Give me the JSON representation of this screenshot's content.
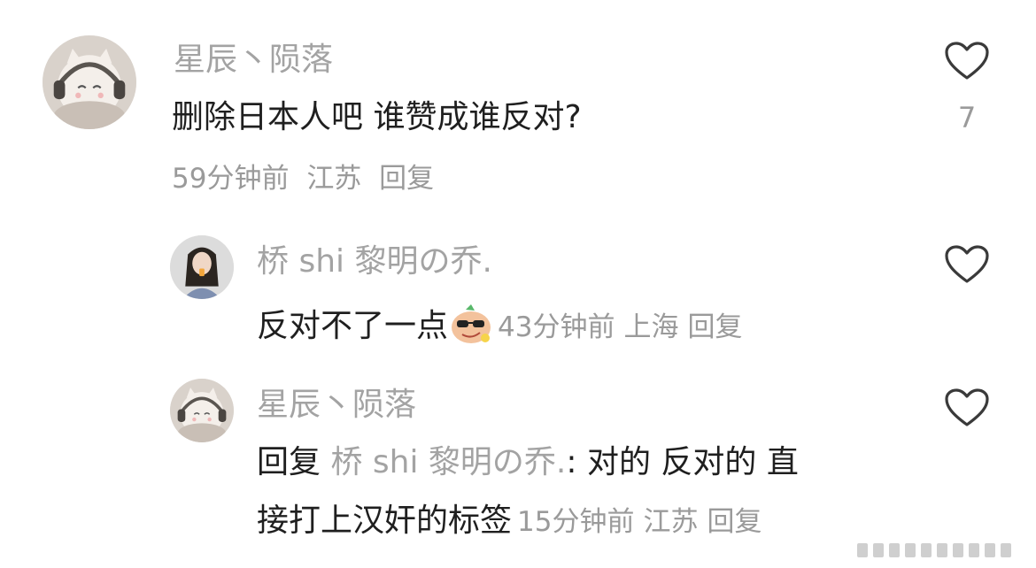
{
  "comment1": {
    "username": "星辰丶陨落",
    "text": "删除日本人吧 谁赞成谁反对?",
    "time": "59分钟前",
    "location": "江苏",
    "reply_label": "回复",
    "like_count": "7",
    "avatar_icon": "cat-headphones-avatar",
    "like_icon": "heart-outline-icon"
  },
  "reply1": {
    "username": "桥 shi 黎明の乔.",
    "text": "反对不了一点",
    "emoji_icon": "sunglasses-sticker-emoji",
    "time": "43分钟前",
    "location": "上海",
    "reply_label": "回复",
    "avatar_icon": "girl-photo-avatar",
    "like_icon": "heart-outline-icon"
  },
  "reply2": {
    "username": "星辰丶陨落",
    "reply_prefix": "回复",
    "reply_target": "桥 shi 黎明の乔.",
    "text_line1": ": 对的 反对的 直",
    "text_line2": "接打上汉奸的标签",
    "time": "15分钟前",
    "location": "江苏",
    "reply_label": "回复",
    "avatar_icon": "cat-headphones-avatar",
    "like_icon": "heart-outline-icon"
  },
  "colors": {
    "username": "#a3a3a3",
    "text": "#1f1f1f",
    "meta": "#9a9a9a",
    "background": "#ffffff"
  }
}
